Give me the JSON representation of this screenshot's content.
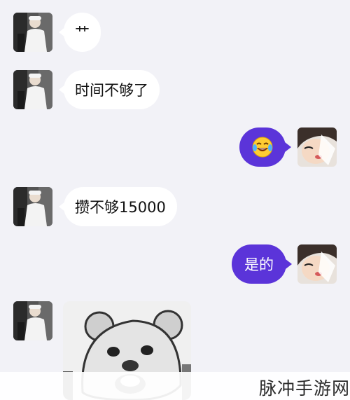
{
  "messages": [
    {
      "side": "in",
      "text": "艹"
    },
    {
      "side": "in",
      "text": "时间不够了"
    },
    {
      "side": "out",
      "emoji": "face-with-tears-of-joy"
    },
    {
      "side": "in",
      "text": "攒不够15000"
    },
    {
      "side": "out",
      "text": "是的"
    },
    {
      "side": "in",
      "sticker": "bear-face-sticker"
    }
  ],
  "watermark": "脉冲手游网",
  "colors": {
    "outgoing_bubble": "#5b34d9",
    "incoming_bubble": "#ffffff",
    "background": "#f2f2f7"
  }
}
